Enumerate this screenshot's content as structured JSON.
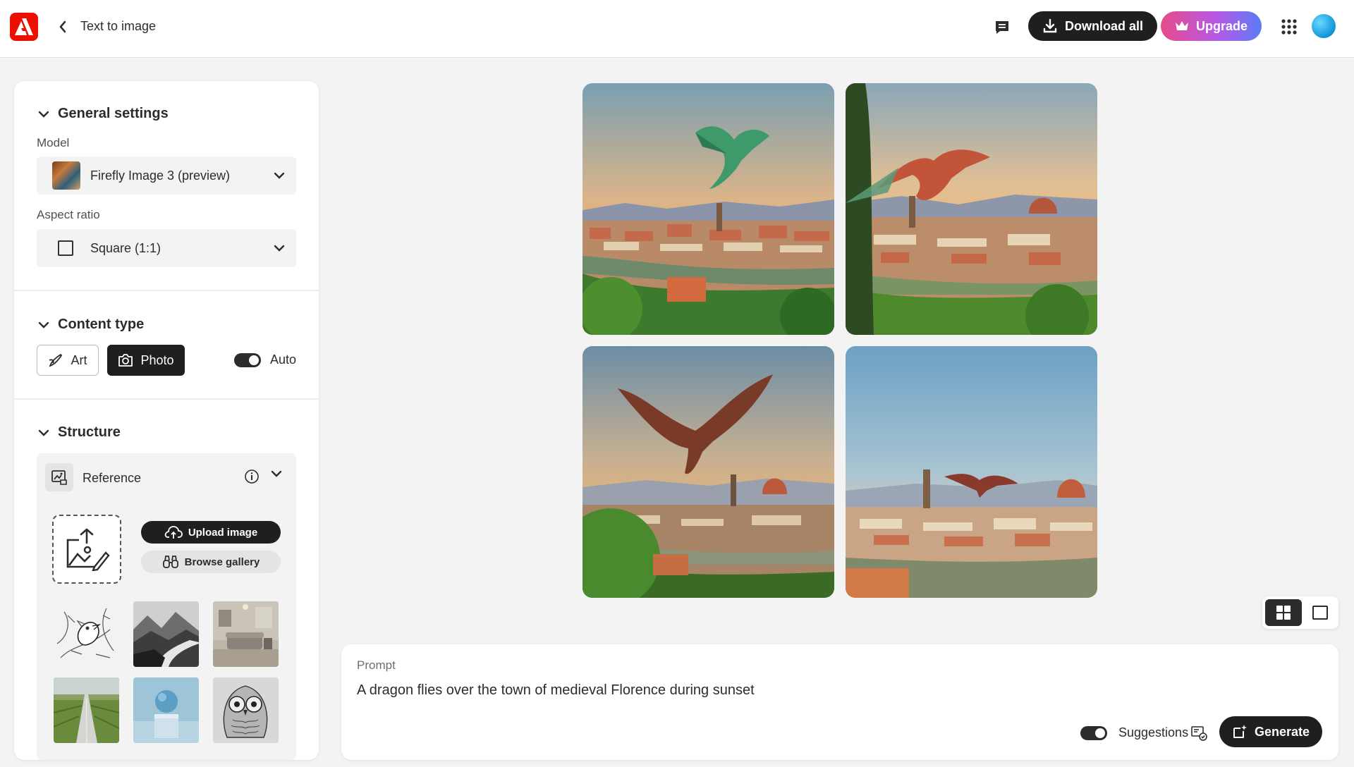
{
  "header": {
    "title": "Text to image",
    "download_all_label": "Download all",
    "upgrade_label": "Upgrade"
  },
  "sidebar": {
    "general_settings": {
      "title": "General settings",
      "model_label": "Model",
      "model_value": "Firefly Image 3 (preview)",
      "aspect_ratio_label": "Aspect ratio",
      "aspect_ratio_value": "Square (1:1)"
    },
    "content_type": {
      "title": "Content type",
      "options": [
        "Art",
        "Photo"
      ],
      "selected": "Photo",
      "auto_label": "Auto",
      "auto_enabled": true
    },
    "structure": {
      "title": "Structure",
      "reference_label": "Reference",
      "upload_label": "Upload image",
      "browse_label": "Browse gallery",
      "reference_thumbnails": [
        "bird sketch",
        "misty mountains",
        "living room",
        "road through fields",
        "sphere on pedestal",
        "owl sketch"
      ]
    }
  },
  "results": {
    "image_count": 4,
    "view_mode": "grid"
  },
  "prompt": {
    "label": "Prompt",
    "text": "A dragon flies over the town of medieval Florence during sunset",
    "suggestions_label": "Suggestions",
    "suggestions_enabled": true,
    "generate_label": "Generate"
  },
  "colors": {
    "brand_red": "#eb1000",
    "dark_button": "#1f1f1f",
    "upgrade_gradient_start": "#e84b8a",
    "upgrade_gradient_end": "#5c7cf5"
  }
}
